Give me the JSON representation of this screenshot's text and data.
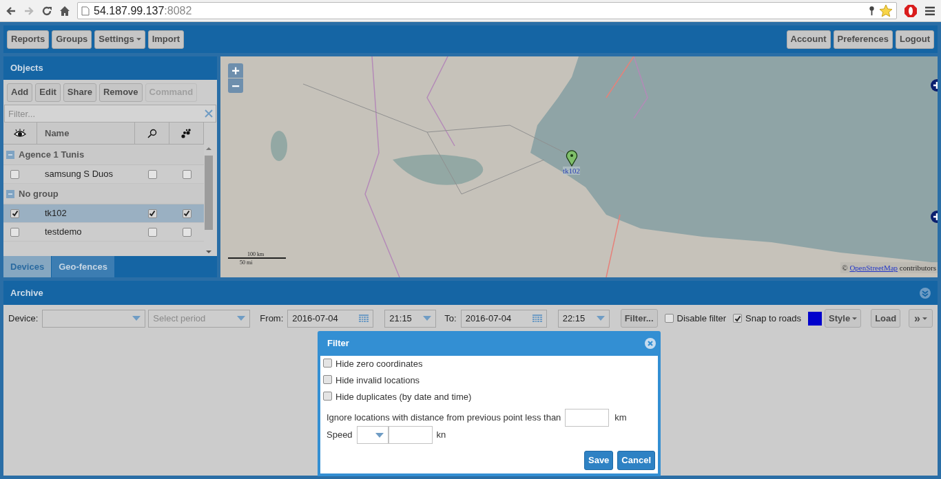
{
  "browser": {
    "url_host": "54.187.99.137",
    "url_port": ":8082"
  },
  "toolbar": {
    "left": [
      {
        "label": "Reports",
        "dropdown": false
      },
      {
        "label": "Groups",
        "dropdown": false
      },
      {
        "label": "Settings",
        "dropdown": true
      },
      {
        "label": "Import",
        "dropdown": false
      }
    ],
    "right": [
      {
        "label": "Account",
        "dropdown": false
      },
      {
        "label": "Preferences",
        "dropdown": false
      },
      {
        "label": "Logout",
        "dropdown": false
      }
    ]
  },
  "objects_panel": {
    "title": "Objects",
    "buttons": [
      {
        "label": "Add",
        "disabled": false
      },
      {
        "label": "Edit",
        "disabled": false
      },
      {
        "label": "Share",
        "disabled": false
      },
      {
        "label": "Remove",
        "disabled": false
      },
      {
        "label": "Command",
        "disabled": true
      }
    ],
    "filter": {
      "placeholder": "Filter..."
    },
    "name_column": "Name",
    "groups": [
      {
        "name": "Agence 1 Tunis",
        "expanded": true,
        "devices": [
          {
            "name": "samsung S Duos",
            "visible": false,
            "follow": false,
            "trail": false,
            "selected": false
          }
        ]
      },
      {
        "name": "No group",
        "expanded": true,
        "devices": [
          {
            "name": "tk102",
            "visible": true,
            "follow": true,
            "trail": true,
            "selected": true
          },
          {
            "name": "testdemo",
            "visible": false,
            "follow": false,
            "trail": false,
            "selected": false
          }
        ]
      }
    ],
    "tabs": [
      {
        "label": "Devices",
        "selected": true
      },
      {
        "label": "Geo-fences",
        "selected": false
      }
    ]
  },
  "map": {
    "zoom_in": "+",
    "zoom_out": "−",
    "marker_label": "tk102",
    "scale": [
      "100 km",
      "50 mi"
    ],
    "attribution": {
      "prefix": "©",
      "link": "OpenStreetMap",
      "suffix": "contributors"
    }
  },
  "archive": {
    "title": "Archive",
    "device_label": "Device:",
    "period": {
      "placeholder": "Select period"
    },
    "from_label": "From:",
    "from_date": "2016-07-04",
    "from_time": "21:15",
    "to_label": "To:",
    "to_date": "2016-07-04",
    "to_time": "22:15",
    "filter_button": "Filter...",
    "options": [
      {
        "label": "Disable filter",
        "checked": false
      },
      {
        "label": "Snap to roads",
        "checked": true
      }
    ],
    "color": "#0000cc",
    "style_button": "Style",
    "load_button": "Load",
    "more_button": "»"
  },
  "filter_dialog": {
    "title": "Filter",
    "options": [
      {
        "label": "Hide zero coordinates",
        "checked": false
      },
      {
        "label": "Hide invalid locations",
        "checked": false
      },
      {
        "label": "Hide duplicates (by date and time)",
        "checked": false
      }
    ],
    "distance": {
      "label": "Ignore locations with distance from previous point less than",
      "unit": "km"
    },
    "speed": {
      "label": "Speed",
      "unit": "kn"
    },
    "buttons": [
      "Save",
      "Cancel"
    ]
  }
}
